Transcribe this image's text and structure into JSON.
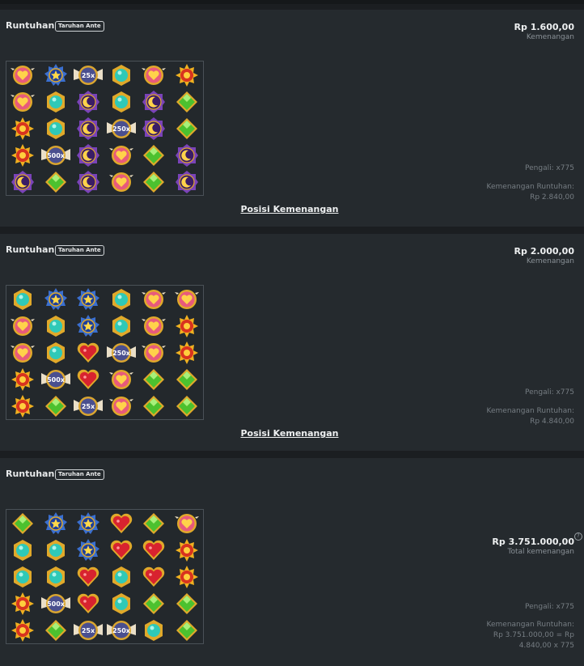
{
  "symbol_names": {
    "heart": "heart-gem-icon",
    "star": "star-gem-icon",
    "teal": "teal-gem-icon",
    "moon": "moon-gem-icon",
    "sun": "sun-gem-icon",
    "green": "green-gem-icon",
    "redheart": "red-heart-gem-icon"
  },
  "rounds": [
    {
      "title": "Runtuhan",
      "badge": "Taruhan Ante",
      "amount": "Rp 1.600,00",
      "amount_label": "Kemenangan",
      "multiplier_text": "Pengali: x775",
      "tumble_label": "Kemenangan Runtuhan:",
      "tumble_value": "Rp 2.840,00",
      "link": "Posisi Kemenangan",
      "grid": [
        [
          "heart",
          "star",
          "mult:25x",
          "teal",
          "heart",
          "sun"
        ],
        [
          "heart",
          "teal",
          "moon",
          "teal",
          "moon",
          "green"
        ],
        [
          "sun",
          "teal",
          "moon",
          "mult:250x",
          "moon",
          "green"
        ],
        [
          "sun",
          "mult:500x",
          "moon",
          "heart",
          "green",
          "moon"
        ],
        [
          "moon",
          "green",
          "moon",
          "heart",
          "green",
          "moon"
        ]
      ]
    },
    {
      "title": "Runtuhan",
      "badge": "Taruhan Ante",
      "amount": "Rp 2.000,00",
      "amount_label": "Kemenangan",
      "multiplier_text": "Pengali: x775",
      "tumble_label": "Kemenangan Runtuhan:",
      "tumble_value": "Rp 4.840,00",
      "link": "Posisi Kemenangan",
      "grid": [
        [
          "teal",
          "star",
          "star",
          "teal",
          "heart",
          "heart"
        ],
        [
          "heart",
          "teal",
          "star",
          "teal",
          "heart",
          "sun"
        ],
        [
          "heart",
          "teal",
          "redheart",
          "mult:250x",
          "heart",
          "sun"
        ],
        [
          "sun",
          "mult:500x",
          "redheart",
          "heart",
          "green",
          "green"
        ],
        [
          "sun",
          "green",
          "mult:25x",
          "heart",
          "green",
          "green"
        ]
      ]
    },
    {
      "title": "Runtuhan",
      "badge": "Taruhan Ante",
      "amount": "Rp 3.751.000,00",
      "amount_label": "Total kemenangan",
      "info_icon": "question-icon",
      "multiplier_text": "Pengali: x775",
      "tumble_label": "Kemenangan Runtuhan:",
      "tumble_value": "Rp 3.751.000,00 = Rp",
      "tumble_value2": "4.840,00 x 775",
      "grid": [
        [
          "green",
          "star",
          "star",
          "redheart",
          "green",
          "heart"
        ],
        [
          "teal",
          "teal",
          "star",
          "redheart",
          "redheart",
          "sun"
        ],
        [
          "teal",
          "teal",
          "redheart",
          "teal",
          "redheart",
          "sun"
        ],
        [
          "sun",
          "mult:500x",
          "redheart",
          "teal",
          "green",
          "green"
        ],
        [
          "sun",
          "green",
          "mult:25x",
          "mult:250x",
          "teal",
          "green"
        ]
      ]
    }
  ]
}
